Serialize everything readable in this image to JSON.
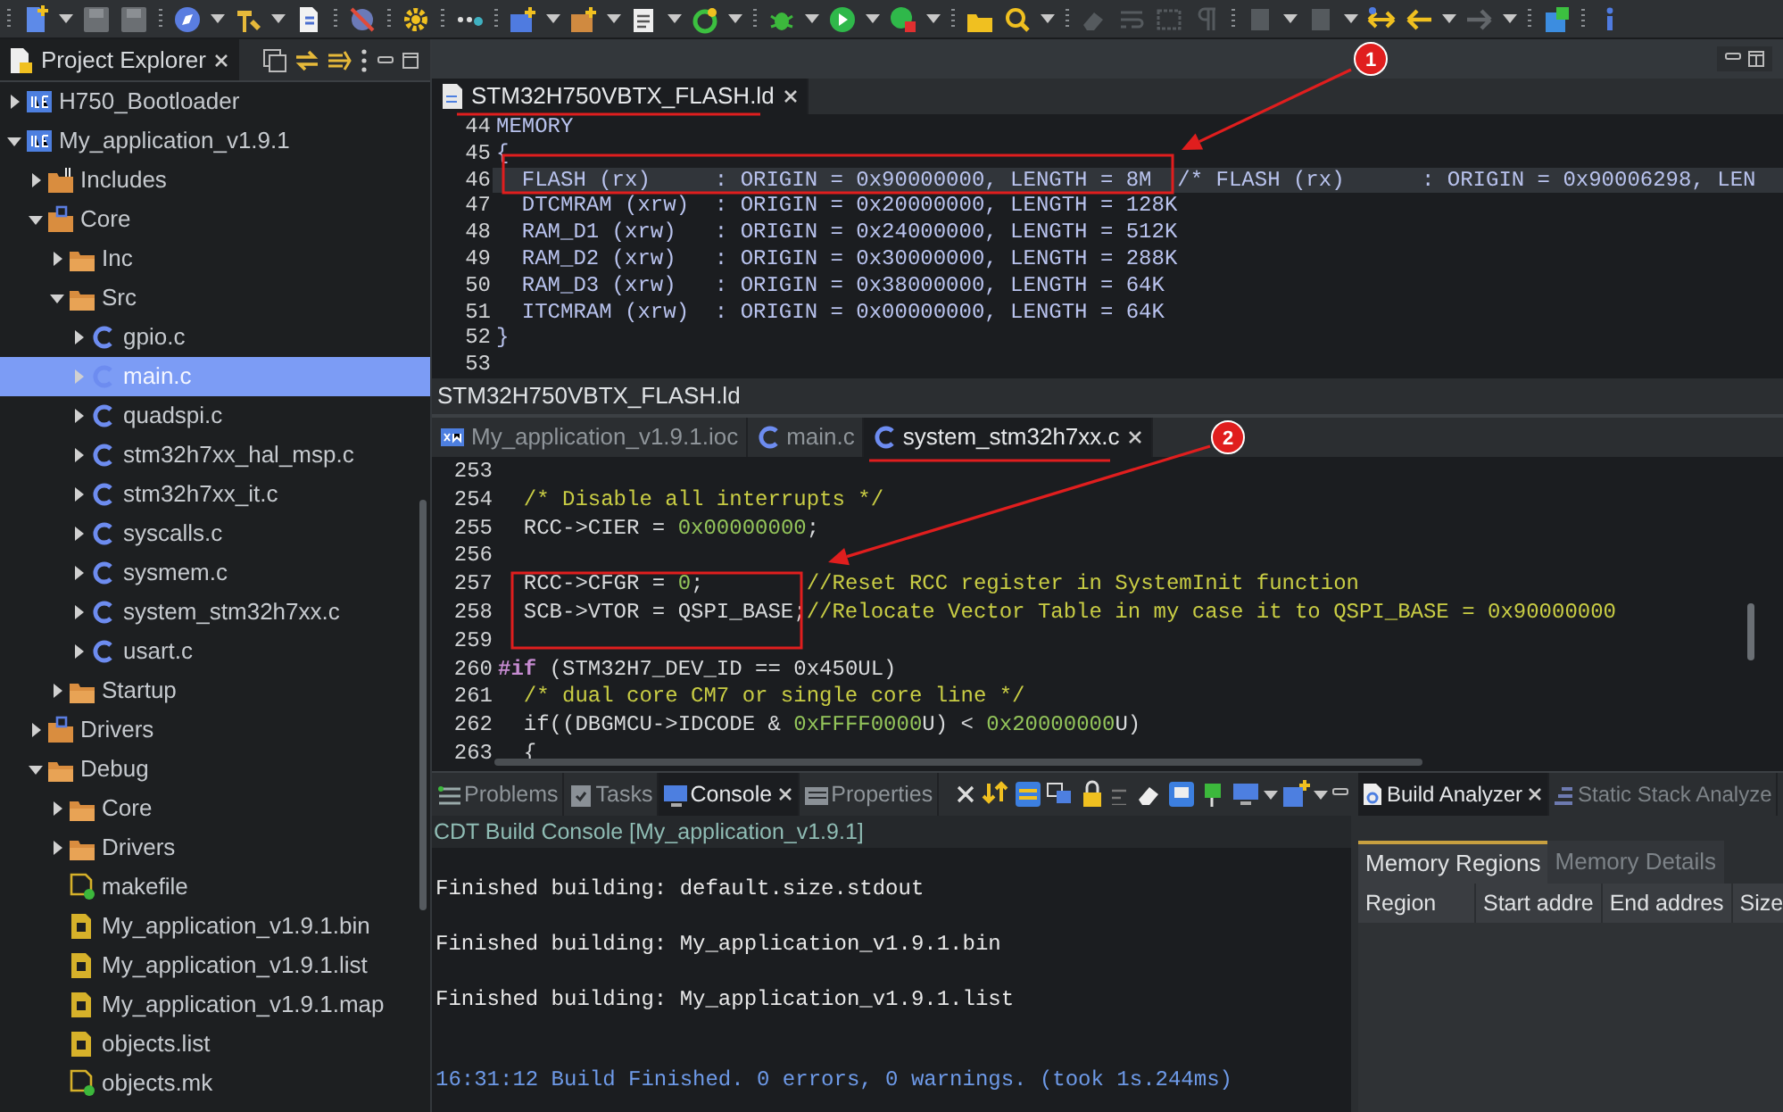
{
  "project_explorer": {
    "title": "Project Explorer",
    "tree": [
      {
        "label": "H750_Bootloader",
        "kind": "project",
        "expanded": false,
        "selected": false
      },
      {
        "label": "My_application_v1.9.1",
        "kind": "project",
        "expanded": true,
        "selected": false,
        "children": [
          {
            "label": "Includes",
            "kind": "includes",
            "expanded": false,
            "selected": false
          },
          {
            "label": "Core",
            "kind": "source-folder",
            "expanded": true,
            "selected": false,
            "children": [
              {
                "label": "Inc",
                "kind": "folder",
                "expanded": false,
                "selected": false
              },
              {
                "label": "Src",
                "kind": "folder",
                "expanded": true,
                "selected": false,
                "children": [
                  {
                    "label": "gpio.c",
                    "kind": "c-file",
                    "expanded": false,
                    "selected": false
                  },
                  {
                    "label": "main.c",
                    "kind": "c-file",
                    "expanded": false,
                    "selected": true
                  },
                  {
                    "label": "quadspi.c",
                    "kind": "c-file",
                    "expanded": false,
                    "selected": false
                  },
                  {
                    "label": "stm32h7xx_hal_msp.c",
                    "kind": "c-file",
                    "expanded": false,
                    "selected": false
                  },
                  {
                    "label": "stm32h7xx_it.c",
                    "kind": "c-file",
                    "expanded": false,
                    "selected": false
                  },
                  {
                    "label": "syscalls.c",
                    "kind": "c-file",
                    "expanded": false,
                    "selected": false
                  },
                  {
                    "label": "sysmem.c",
                    "kind": "c-file",
                    "expanded": false,
                    "selected": false
                  },
                  {
                    "label": "system_stm32h7xx.c",
                    "kind": "c-file",
                    "expanded": false,
                    "selected": false
                  },
                  {
                    "label": "usart.c",
                    "kind": "c-file",
                    "expanded": false,
                    "selected": false
                  }
                ]
              },
              {
                "label": "Startup",
                "kind": "folder",
                "expanded": false,
                "selected": false
              }
            ]
          },
          {
            "label": "Drivers",
            "kind": "source-folder",
            "expanded": false,
            "selected": false
          },
          {
            "label": "Debug",
            "kind": "folder",
            "expanded": true,
            "selected": false,
            "children": [
              {
                "label": "Core",
                "kind": "folder",
                "expanded": false,
                "selected": false
              },
              {
                "label": "Drivers",
                "kind": "folder",
                "expanded": false,
                "selected": false
              },
              {
                "label": "makefile",
                "kind": "make-file",
                "selected": false
              },
              {
                "label": "My_application_v1.9.1.bin",
                "kind": "data-file",
                "selected": false
              },
              {
                "label": "My_application_v1.9.1.list",
                "kind": "data-file",
                "selected": false
              },
              {
                "label": "My_application_v1.9.1.map",
                "kind": "data-file",
                "selected": false
              },
              {
                "label": "objects.list",
                "kind": "data-file",
                "selected": false
              },
              {
                "label": "objects.mk",
                "kind": "make-file",
                "selected": false
              }
            ]
          }
        ]
      }
    ]
  },
  "editor_top": {
    "tabs": [
      {
        "label": "STM32H750VBTX_FLASH.ld",
        "kind": "ld",
        "selected": true
      }
    ],
    "lines": [
      {
        "number": "44",
        "current": false,
        "segments": [
          {
            "text": "MEMORY",
            "kind": "ld"
          }
        ]
      },
      {
        "number": "45",
        "current": false,
        "segments": [
          {
            "text": "{",
            "kind": "ld"
          }
        ]
      },
      {
        "number": "46",
        "current": true,
        "segments": [
          {
            "text": "  FLASH (rx)     : ORIGIN = 0x90000000, LENGTH = 8M  /* FLASH (rx)      : ORIGIN = 0x90006298, LEN",
            "kind": "ld"
          }
        ]
      },
      {
        "number": "47",
        "current": false,
        "segments": [
          {
            "text": "  DTCMRAM (xrw)  : ORIGIN = 0x20000000, LENGTH = 128K",
            "kind": "ld"
          }
        ]
      },
      {
        "number": "48",
        "current": false,
        "segments": [
          {
            "text": "  RAM_D1 (xrw)   : ORIGIN = 0x24000000, LENGTH = 512K",
            "kind": "ld"
          }
        ]
      },
      {
        "number": "49",
        "current": false,
        "segments": [
          {
            "text": "  RAM_D2 (xrw)   : ORIGIN = 0x30000000, LENGTH = 288K",
            "kind": "ld"
          }
        ]
      },
      {
        "number": "50",
        "current": false,
        "segments": [
          {
            "text": "  RAM_D3 (xrw)   : ORIGIN = 0x38000000, LENGTH = 64K",
            "kind": "ld"
          }
        ]
      },
      {
        "number": "51",
        "current": false,
        "segments": [
          {
            "text": "  ITCMRAM (xrw)  : ORIGIN = 0x00000000, LENGTH = 64K",
            "kind": "ld"
          }
        ]
      },
      {
        "number": "52",
        "current": false,
        "segments": [
          {
            "text": "}",
            "kind": "ld"
          }
        ]
      },
      {
        "number": "53",
        "current": false
      }
    ],
    "footer_label": "STM32H750VBTX_FLASH.ld"
  },
  "editor_bottom": {
    "tabs": [
      {
        "label": "My_application_v1.9.1.ioc",
        "kind": "ioc",
        "selected": false
      },
      {
        "label": "main.c",
        "kind": "c",
        "selected": false
      },
      {
        "label": "system_stm32h7xx.c",
        "kind": "c",
        "selected": true
      }
    ],
    "lines": [
      {
        "number": "253",
        "current": false
      },
      {
        "number": "254",
        "current": false,
        "segments": [
          {
            "text": "  /* Disable all interrupts */",
            "kind": "comment"
          }
        ]
      },
      {
        "number": "255",
        "current": false,
        "segments": [
          {
            "text": "  RCC->CIER = ",
            "kind": "plain"
          },
          {
            "text": "0x00000000",
            "kind": "number"
          },
          {
            "text": ";",
            "kind": "plain"
          }
        ]
      },
      {
        "number": "256",
        "current": false
      },
      {
        "number": "257",
        "current": false,
        "segments": [
          {
            "text": "  RCC->CFGR = ",
            "kind": "plain"
          },
          {
            "text": "0",
            "kind": "number"
          },
          {
            "text": ";        ",
            "kind": "plain"
          },
          {
            "text": "//Reset RCC register in SystemInit function",
            "kind": "comment"
          }
        ]
      },
      {
        "number": "258",
        "current": false,
        "segments": [
          {
            "text": "  SCB->VTOR = QSPI_BASE;",
            "kind": "plain"
          },
          {
            "text": "//Relocate Vector Table in my case it to QSPI_BASE = 0x90000000",
            "kind": "comment"
          }
        ]
      },
      {
        "number": "259",
        "current": false
      },
      {
        "number": "260",
        "current": false,
        "segments": [
          {
            "text": "#if",
            "kind": "directive"
          },
          {
            "text": " (STM32H7_DEV_ID == 0x450UL)",
            "kind": "plain"
          }
        ]
      },
      {
        "number": "261",
        "current": false,
        "segments": [
          {
            "text": "  /* dual core CM7 or single core line */",
            "kind": "comment"
          }
        ]
      },
      {
        "number": "262",
        "current": false,
        "segments": [
          {
            "text": "  if((DBGMCU->IDCODE & ",
            "kind": "plain"
          },
          {
            "text": "0xFFFF0000",
            "kind": "number"
          },
          {
            "text": "U) < ",
            "kind": "plain"
          },
          {
            "text": "0x20000000",
            "kind": "number"
          },
          {
            "text": "U)",
            "kind": "plain"
          }
        ]
      },
      {
        "number": "263",
        "current": false,
        "segments": [
          {
            "text": "  {",
            "kind": "plain"
          }
        ]
      }
    ]
  },
  "console_panel": {
    "tabs": [
      {
        "label": "Problems",
        "kind": "problems",
        "selected": false
      },
      {
        "label": "Tasks",
        "kind": "tasks",
        "selected": false
      },
      {
        "label": "Console",
        "kind": "console",
        "selected": true
      },
      {
        "label": "Properties",
        "kind": "properties",
        "selected": false
      }
    ],
    "console_title": "CDT Build Console [My_application_v1.9.1]",
    "lines": [
      {
        "text": "Finished building: default.size.stdout",
        "kind": "output"
      },
      {
        "text": "Finished building: My_application_v1.9.1.bin",
        "kind": "output"
      },
      {
        "text": "Finished building: My_application_v1.9.1.list",
        "kind": "output"
      },
      {
        "text": "16:31:12 Build Finished. 0 errors, 0 warnings. (took 1s.244ms)",
        "kind": "status"
      }
    ]
  },
  "build_analyzer": {
    "tabs": [
      {
        "label": "Build Analyzer",
        "selected": true
      },
      {
        "label": "Static Stack Analyze",
        "selected": false
      }
    ],
    "subtabs": [
      {
        "label": "Memory Regions",
        "selected": true
      },
      {
        "label": "Memory Details",
        "selected": false
      }
    ],
    "columns": [
      "Region",
      "Start addre",
      "End addres",
      "Size"
    ]
  },
  "annotations": [
    {
      "number": "1"
    },
    {
      "number": "2"
    }
  ]
}
